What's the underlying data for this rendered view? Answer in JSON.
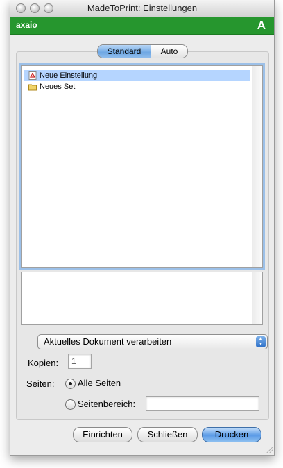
{
  "window": {
    "title": "MadeToPrint:  Einstellungen"
  },
  "brand": {
    "name": "axaio",
    "logo_letter": "A",
    "color": "#26962e"
  },
  "tabs": [
    {
      "label": "Standard",
      "selected": true
    },
    {
      "label": "Auto",
      "selected": false
    }
  ],
  "list": {
    "items": [
      {
        "label": "Neue Einstellung",
        "icon": "pdf-document-icon",
        "selected": true
      },
      {
        "label": "Neues Set",
        "icon": "folder-icon",
        "selected": false
      }
    ]
  },
  "options": {
    "mode_value": "Aktuelles Dokument verarbeiten",
    "copies_label": "Kopien:",
    "copies_value": "1",
    "pages_label": "Seiten:",
    "all_pages_label": "Alle Seiten",
    "range_label": "Seitenbereich:",
    "range_value": "",
    "selected_pages_option": "Alle Seiten"
  },
  "buttons": {
    "setup": "Einrichten",
    "close": "Schließen",
    "print": "Drucken"
  },
  "colors": {
    "accent": "#5a9ae6",
    "selection": "#b5d5ff"
  }
}
